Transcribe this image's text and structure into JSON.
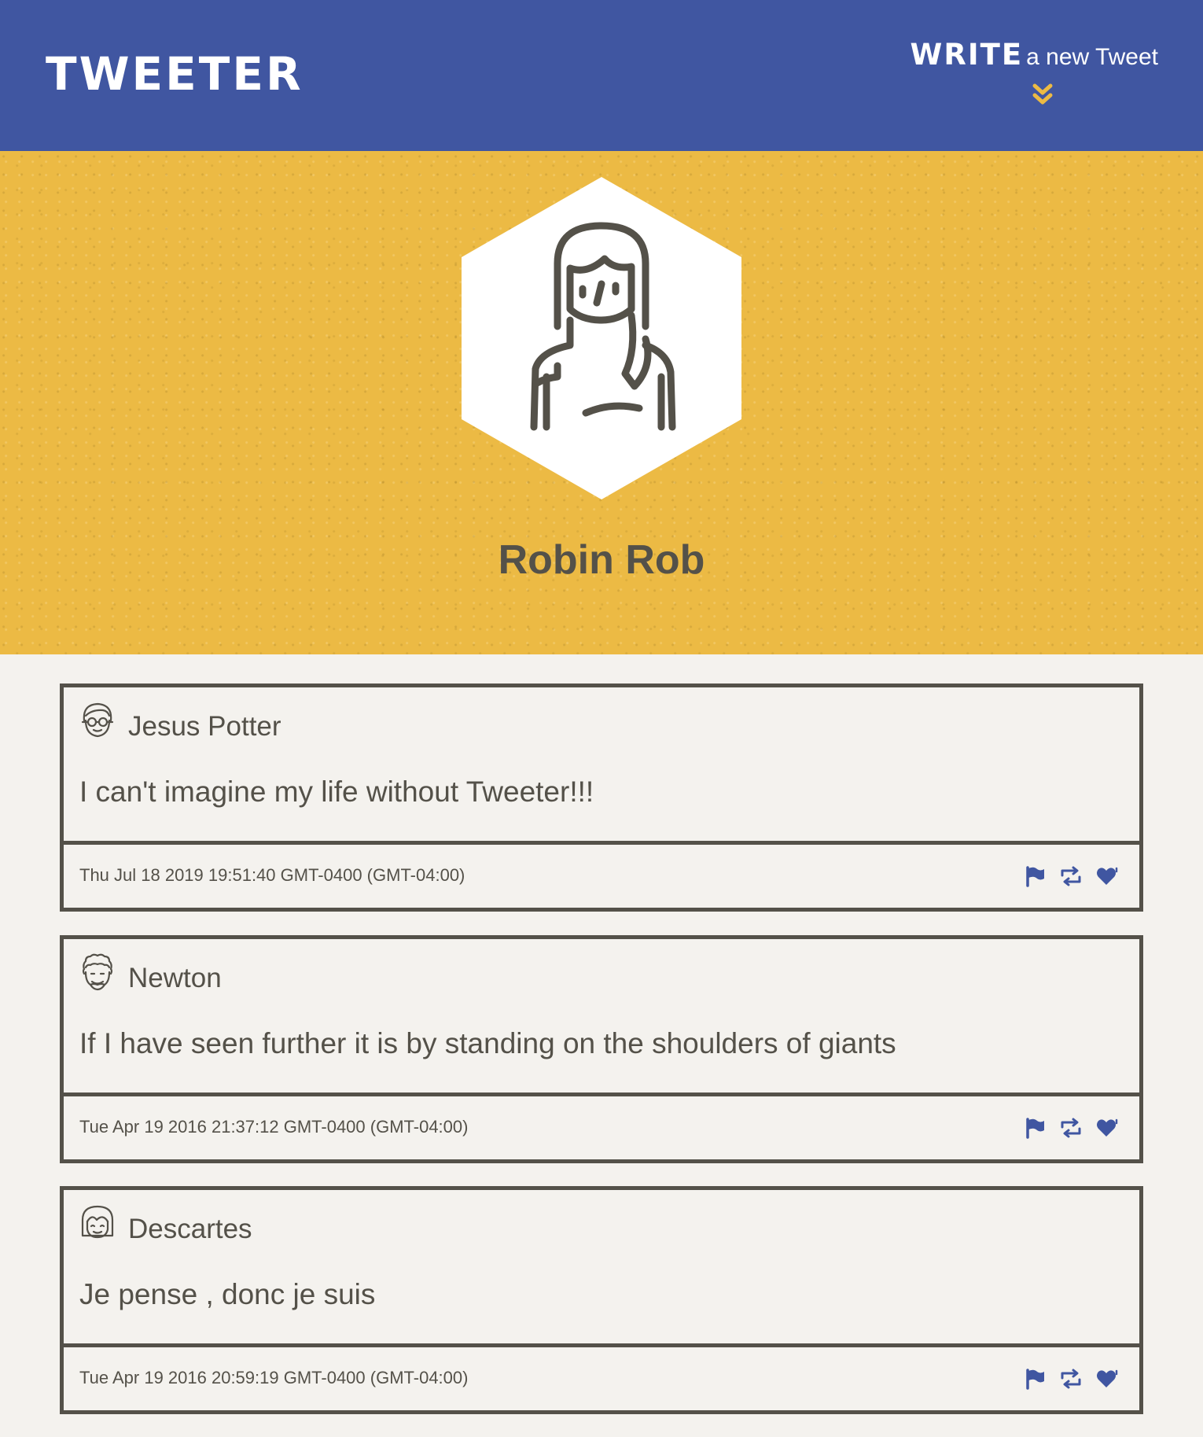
{
  "nav": {
    "brand": "TWEETER",
    "compose_strong": "WRITE",
    "compose_rest": "a new Tweet",
    "accent_color": "#4056a1",
    "arrow_color": "#ecba44"
  },
  "profile": {
    "name": "Robin Rob",
    "background_color": "#ecba44"
  },
  "tweets": [
    {
      "user": "Jesus Potter",
      "avatar_icon": "man-glasses-avatar-icon",
      "text": "I can't imagine my life without Tweeter!!!",
      "date": "Thu Jul 18 2019 19:51:40 GMT-0400 (GMT-04:00)"
    },
    {
      "user": "Newton",
      "avatar_icon": "curly-hair-man-avatar-icon",
      "text": "If I have seen further it is by standing on the shoulders of giants",
      "date": "Tue Apr 19 2016 21:37:12 GMT-0400 (GMT-04:00)"
    },
    {
      "user": "Descartes",
      "avatar_icon": "bob-hair-avatar-icon",
      "text": "Je pense , donc je suis",
      "date": "Tue Apr 19 2016 20:59:19 GMT-0400 (GMT-04:00)"
    }
  ],
  "tweet_actions": [
    "flag-icon",
    "retweet-icon",
    "heart-icon"
  ]
}
